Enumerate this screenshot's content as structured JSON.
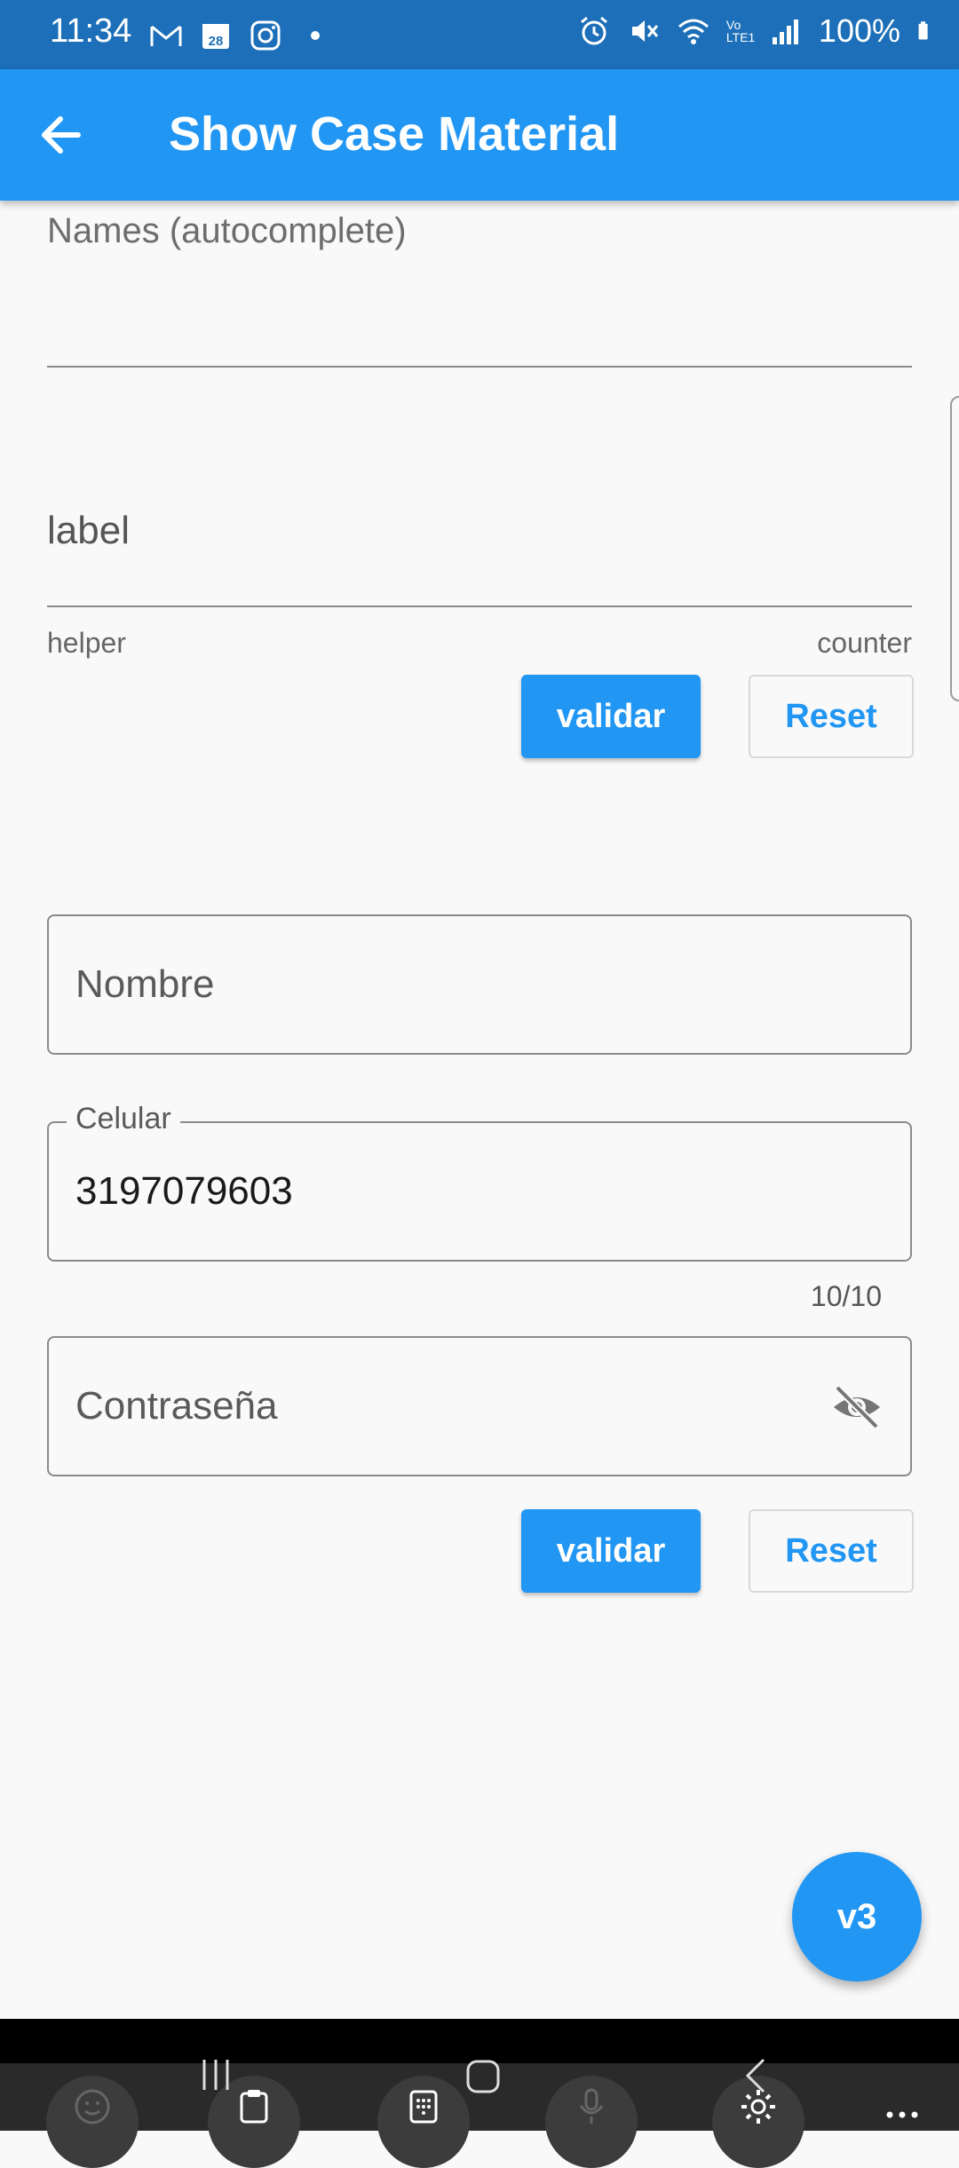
{
  "status_bar": {
    "time": "11:34",
    "calendar_day": "28",
    "battery": "100%",
    "network": "Vo LTE1"
  },
  "app_bar": {
    "title": "Show Case Material"
  },
  "autocomplete": {
    "label": "Names (autocomplete)"
  },
  "text_field": {
    "label": "label",
    "helper": "helper",
    "counter": "counter"
  },
  "form1_buttons": {
    "validate": "validar",
    "reset": "Reset"
  },
  "nombre_field": {
    "placeholder": "Nombre"
  },
  "celular_field": {
    "label": "Celular",
    "value": "3197079603",
    "counter": "10/10"
  },
  "password_field": {
    "placeholder": "Contraseña"
  },
  "form2_buttons": {
    "validate": "validar",
    "reset": "Reset"
  },
  "fab": {
    "label": "v3"
  },
  "colors": {
    "primary": "#2196f3",
    "status_bar": "#1c6fb8",
    "background": "#f9f9f9"
  }
}
